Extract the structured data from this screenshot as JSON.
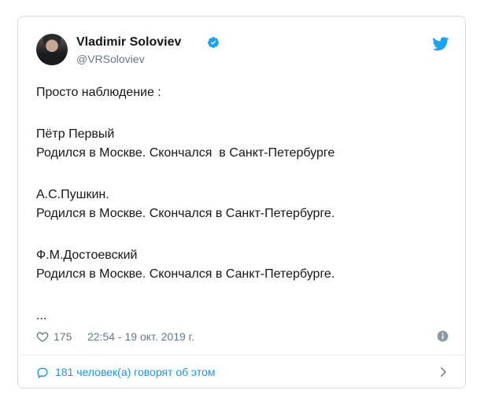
{
  "tweet": {
    "author_name": "Vladimir Soloviev",
    "handle": "@VRSoloviev",
    "lines": [
      "Просто наблюдение :",
      "",
      "Пётр Первый",
      "Родился в Москве. Скончался  в Санкт-Петербурге",
      "",
      "А.С.Пушкин.",
      "Родился в Москве. Скончался в Санкт-Петербурге.",
      "",
      "Ф.М.Достоевский",
      "Родился в Москве. Скончался в Санкт-Петербурге.",
      "",
      "..."
    ],
    "likes": "175",
    "timestamp": "22:54 - 19 окт. 2019 г.",
    "conversation_label": "181 человек(а) говорят об этом"
  },
  "icons": {
    "verified": "verified-badge-icon",
    "logo": "twitter-bird-icon",
    "like": "heart-icon",
    "info": "info-icon",
    "conversation": "speech-bubble-icon",
    "chevron": "chevron-right-icon"
  },
  "colors": {
    "accent": "#1da1f2",
    "link": "#1b95e0",
    "muted": "#657786",
    "text": "#14171a",
    "border": "#d6dce1"
  }
}
